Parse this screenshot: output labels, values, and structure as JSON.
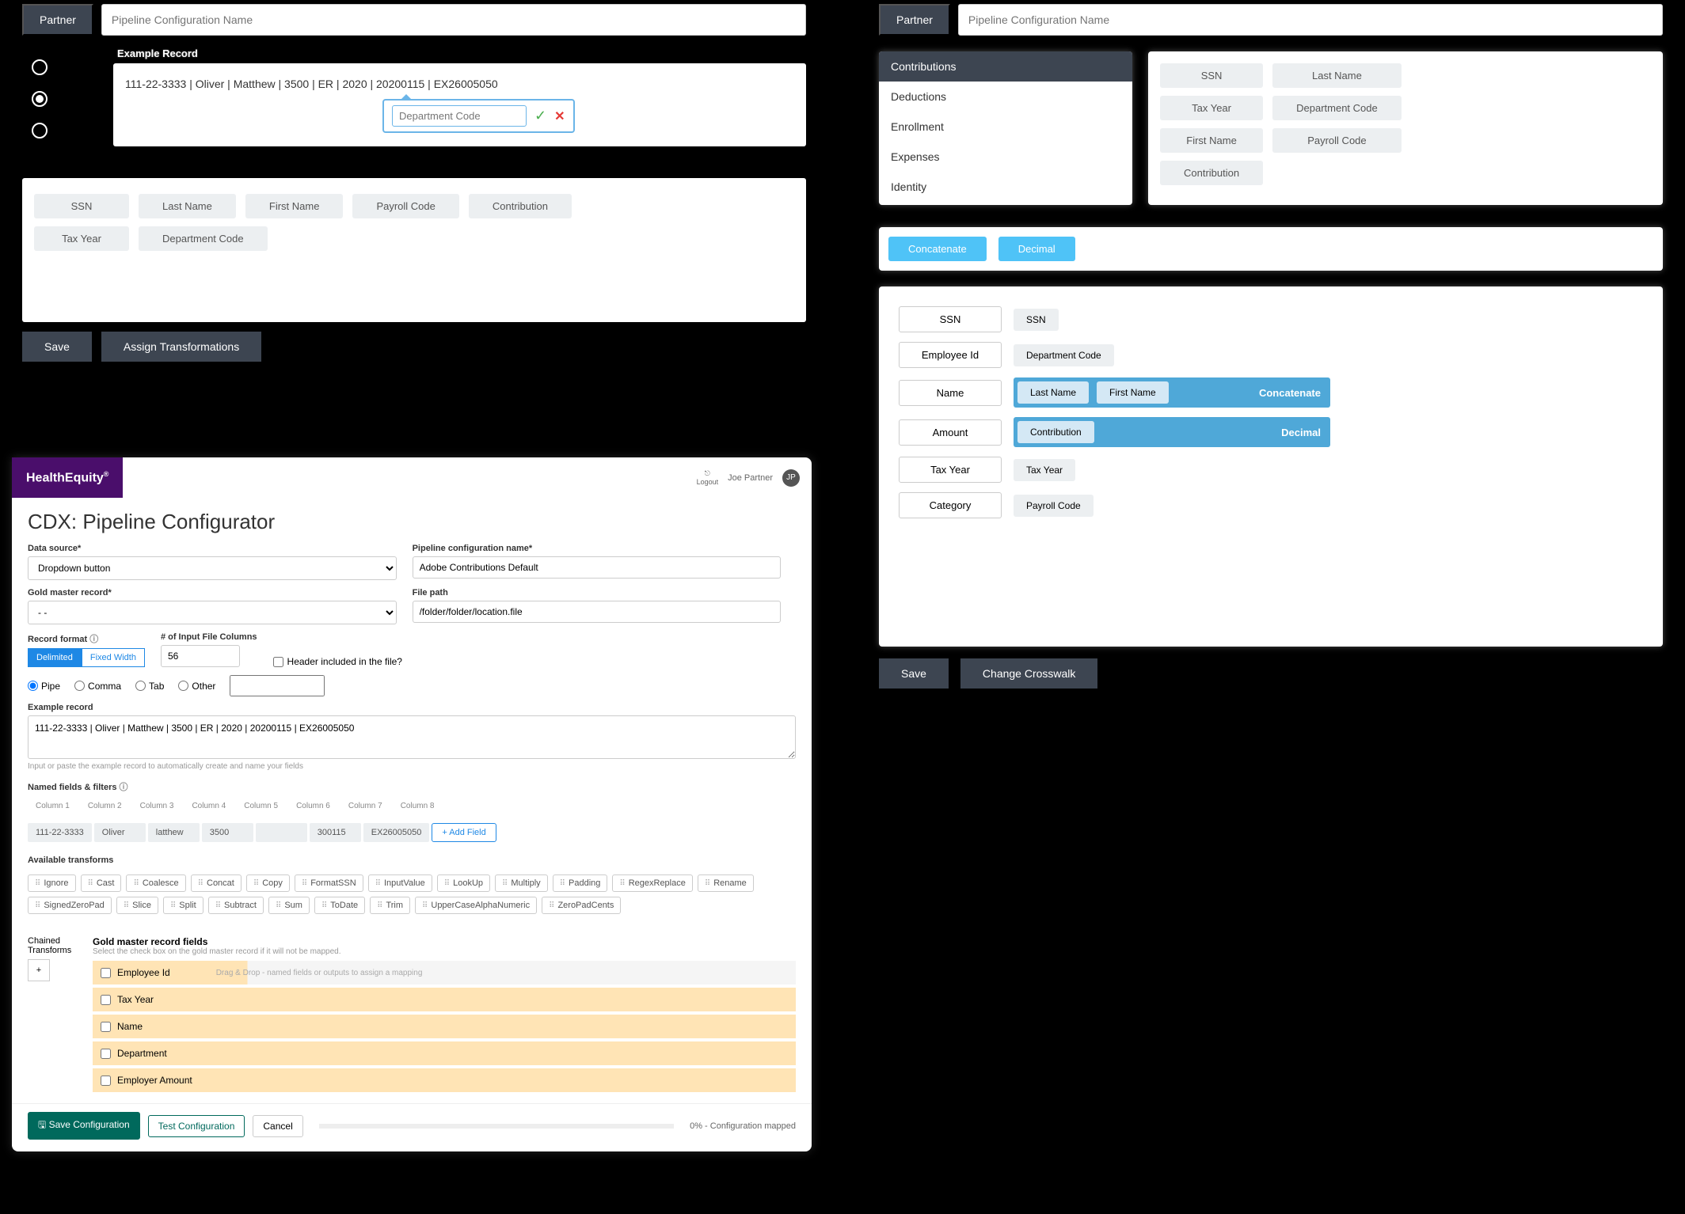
{
  "panelA": {
    "partnerBtn": "Partner",
    "configPlaceholder": "Pipeline Configuration Name",
    "exampleLabel": "Example Record",
    "exampleText": "111-22-3333 | Oliver | Matthew | 3500 | ER | 2020 | 20200115 | EX26005050",
    "popoverValue": "Department Code",
    "chips": [
      "SSN",
      "Last Name",
      "First Name",
      "Payroll Code",
      "Contribution",
      "Tax Year",
      "Department Code"
    ],
    "saveBtn": "Save",
    "assignBtn": "Assign Transformations"
  },
  "panelB": {
    "brand": "HealthEquity",
    "logout": "Logout",
    "userName": "Joe Partner",
    "userInitials": "JP",
    "title": "CDX: Pipeline Configurator",
    "dataSourceLabel": "Data source*",
    "dataSourceValue": "Dropdown button",
    "configNameLabel": "Pipeline configuration name*",
    "configNameValue": "Adobe Contributions Default",
    "goldMasterLabel": "Gold master record*",
    "goldMasterValue": "- -",
    "filePathLabel": "File path",
    "filePathValue": "/folder/folder/location.file",
    "recordFormatLabel": "Record format",
    "segDelimited": "Delimited",
    "segFixedWidth": "Fixed Width",
    "numColsLabel": "# of Input File Columns",
    "numColsValue": "56",
    "headerCheckLabel": "Header included in the file?",
    "delimiters": {
      "pipe": "Pipe",
      "comma": "Comma",
      "tab": "Tab",
      "other": "Other"
    },
    "exampleRecordLabel": "Example record",
    "exampleRecordValue": "111-22-3333 | Oliver | Matthew | 3500 | ER | 2020 | 20200115 | EX26005050",
    "exampleHint": "Input or paste the example record to automatically create and name your fields",
    "namedFieldsLabel": "Named fields & filters",
    "colHeaders": [
      "Column 1",
      "Column 2",
      "Column 3",
      "Column 4",
      "Column 5",
      "Column 6",
      "Column 7",
      "Column 8"
    ],
    "colValues": [
      "111-22-3333",
      "Oliver",
      "latthew",
      "3500",
      "",
      "300115",
      "EX26005050"
    ],
    "addFieldBtn": "+  Add Field",
    "availTransformsLabel": "Available transforms",
    "transforms": [
      "Ignore",
      "Cast",
      "Coalesce",
      "Concat",
      "Copy",
      "FormatSSN",
      "InputValue",
      "LookUp",
      "Multiply",
      "Padding",
      "RegexReplace",
      "Rename",
      "SignedZeroPad",
      "Slice",
      "Split",
      "Subtract",
      "Sum",
      "ToDate",
      "Trim",
      "UpperCaseAlphaNumeric",
      "ZeroPadCents"
    ],
    "chainedLabel": "Chained Transforms",
    "masterLabel": "Gold master record fields",
    "masterSub": "Select the check box on the gold master record if it will not be mapped.",
    "masterRows": [
      "Employee Id",
      "Tax Year",
      "Name",
      "Department",
      "Employer Amount"
    ],
    "dragDropHint": "Drag & Drop - named fields or outputs to assign a mapping",
    "saveConfigBtn": "Save Configuration",
    "testConfigBtn": "Test Configuration",
    "cancelBtn": "Cancel",
    "progressText": "0% - Configuration mapped"
  },
  "panelC": {
    "partnerBtn": "Partner",
    "configPlaceholder": "Pipeline Configuration Name",
    "listItems": [
      "Contributions",
      "Deductions",
      "Enrollment",
      "Expenses",
      "Identity"
    ],
    "chipsCol1": [
      "SSN",
      "Tax Year",
      "First Name",
      "Contribution"
    ],
    "chipsCol2": [
      "Last Name",
      "Department Code",
      "Payroll Code"
    ],
    "transformBtns": [
      "Concatenate",
      "Decimal"
    ],
    "mapping": [
      {
        "label": "SSN",
        "chips": [
          "SSN"
        ],
        "op": null
      },
      {
        "label": "Employee Id",
        "chips": [
          "Department Code"
        ],
        "op": null
      },
      {
        "label": "Name",
        "chips": [
          "Last Name",
          "First Name"
        ],
        "op": "Concatenate"
      },
      {
        "label": "Amount",
        "chips": [
          "Contribution"
        ],
        "op": "Decimal"
      },
      {
        "label": "Tax Year",
        "chips": [
          "Tax Year"
        ],
        "op": null
      },
      {
        "label": "Category",
        "chips": [
          "Payroll Code"
        ],
        "op": null
      }
    ],
    "saveBtn": "Save",
    "changeCrosswalkBtn": "Change Crosswalk"
  }
}
